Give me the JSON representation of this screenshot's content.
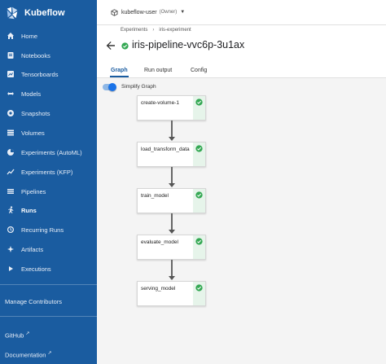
{
  "brand": {
    "name": "Kubeflow",
    "logo_icon": "kubeflow-logo"
  },
  "sidebar": {
    "items": [
      {
        "label": "Home",
        "icon": "home-icon"
      },
      {
        "label": "Notebooks",
        "icon": "notebook-icon"
      },
      {
        "label": "Tensorboards",
        "icon": "tensorboard-icon"
      },
      {
        "label": "Models",
        "icon": "models-icon"
      },
      {
        "label": "Snapshots",
        "icon": "snapshot-icon"
      },
      {
        "label": "Volumes",
        "icon": "volumes-icon"
      },
      {
        "label": "Experiments (AutoML)",
        "icon": "automl-icon"
      },
      {
        "label": "Experiments (KFP)",
        "icon": "kfp-icon"
      },
      {
        "label": "Pipelines",
        "icon": "pipelines-icon"
      },
      {
        "label": "Runs",
        "icon": "runs-icon",
        "active": true
      },
      {
        "label": "Recurring Runs",
        "icon": "recurring-icon"
      },
      {
        "label": "Artifacts",
        "icon": "artifacts-icon"
      },
      {
        "label": "Executions",
        "icon": "executions-icon"
      }
    ],
    "manage_contributors": "Manage Contributors",
    "github": "GitHub",
    "documentation": "Documentation"
  },
  "namespace": {
    "name": "kubeflow-user",
    "role": "(Owner)"
  },
  "breadcrumbs": [
    "Experiments",
    "iris-experiment"
  ],
  "run": {
    "title": "iris-pipeline-vvc6p-3u1ax",
    "status": "succeeded"
  },
  "tabs": [
    "Graph",
    "Run output",
    "Config"
  ],
  "graph": {
    "simplify_label": "Simplify Graph",
    "simplify_on": true,
    "nodes": [
      {
        "label": "create-volume-1",
        "status": "succeeded"
      },
      {
        "label": "load_transform_data",
        "status": "succeeded"
      },
      {
        "label": "train_model",
        "status": "succeeded"
      },
      {
        "label": "evaluate_model",
        "status": "succeeded"
      },
      {
        "label": "serving_model",
        "status": "succeeded"
      }
    ]
  },
  "colors": {
    "sidebar": "#1a5ca0",
    "accent": "#1a73e8",
    "success": "#34a853"
  }
}
